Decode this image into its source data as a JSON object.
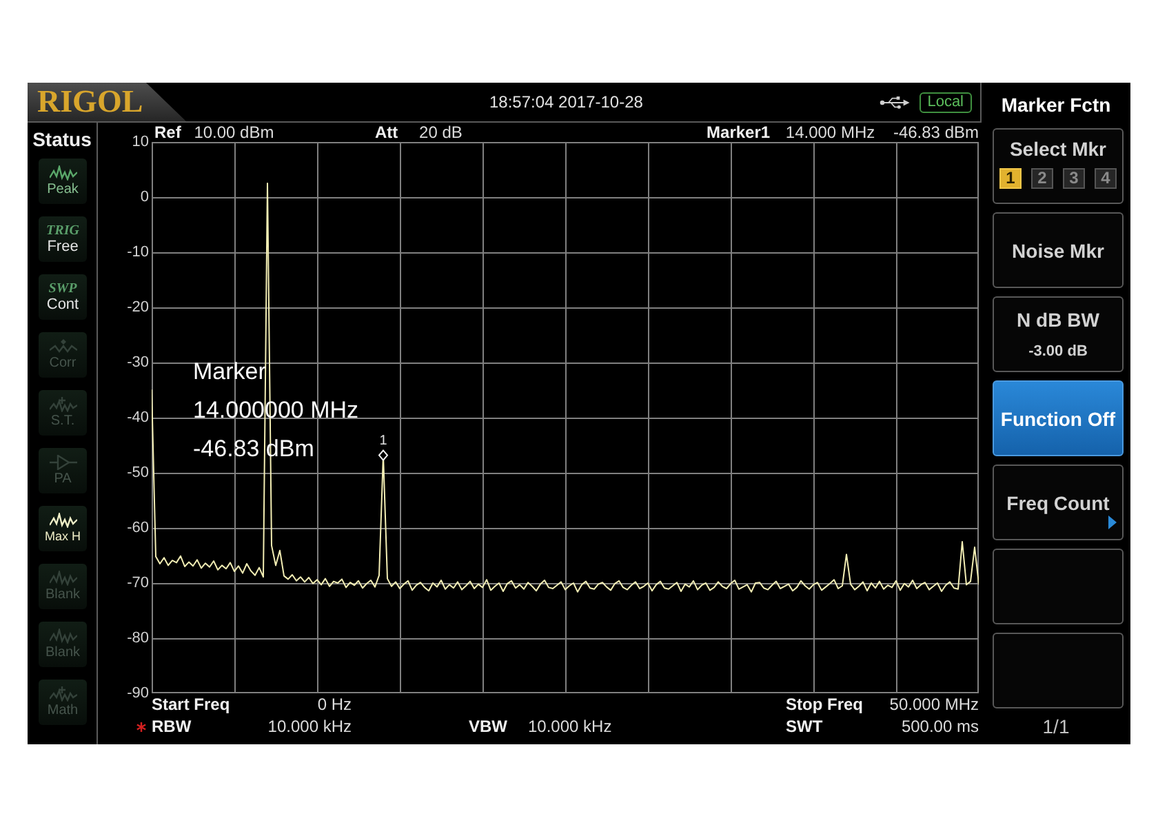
{
  "top_bar": {
    "logo": "RIGOL",
    "datetime": "18:57:04 2017-10-28",
    "remote_mode": "Local"
  },
  "status_panel": {
    "title": "Status",
    "items": [
      {
        "kind": "wave",
        "label": "Peak",
        "on": true,
        "selected": false
      },
      {
        "kind": "text",
        "heading": "TRIG",
        "label": "Free",
        "on": true,
        "selected": false
      },
      {
        "kind": "text",
        "heading": "SWP",
        "label": "Cont",
        "on": true,
        "selected": false
      },
      {
        "kind": "corr",
        "label": "Corr",
        "on": false,
        "selected": false
      },
      {
        "kind": "plus",
        "label": "S.T.",
        "on": false,
        "selected": false
      },
      {
        "kind": "amplifier",
        "label": "PA",
        "on": false,
        "selected": false
      },
      {
        "kind": "wave",
        "label": "Max H",
        "on": true,
        "selected": true
      },
      {
        "kind": "wave",
        "label": "Blank",
        "on": false,
        "selected": false
      },
      {
        "kind": "wave",
        "label": "Blank",
        "on": false,
        "selected": false
      },
      {
        "kind": "plus",
        "label": "Math",
        "on": false,
        "selected": false
      }
    ]
  },
  "plot": {
    "header": [
      {
        "label": "Ref",
        "value": "10.00 dBm"
      },
      {
        "label": "Att",
        "value": "20 dB"
      },
      {
        "label": "Marker1",
        "value": "14.000 MHz",
        "reading": "-46.83 dBm"
      }
    ],
    "chart_data": {
      "type": "line",
      "grid": true,
      "ylim": [
        -90,
        10
      ],
      "yticks": [
        10,
        0,
        -10,
        -20,
        -30,
        -40,
        -50,
        -60,
        -70,
        -80,
        -90
      ],
      "categories": [
        null,
        null,
        null,
        null,
        null,
        null,
        null,
        null,
        null,
        null,
        null,
        null,
        null,
        null,
        null,
        null,
        null,
        null,
        null,
        null,
        null,
        null,
        null,
        null,
        null,
        null,
        null,
        null,
        null,
        null,
        null,
        null,
        null,
        null,
        null,
        null,
        null,
        null,
        null,
        null,
        null,
        null,
        null,
        null,
        null,
        null,
        null,
        null,
        null,
        null,
        null,
        null,
        null,
        null,
        null,
        null,
        null,
        null,
        null,
        null,
        null,
        null,
        null,
        null,
        null,
        null,
        null,
        null,
        null,
        null,
        null,
        null,
        null,
        null,
        null,
        null,
        null,
        null,
        null,
        null,
        null,
        null,
        null,
        null,
        null,
        null,
        null,
        null,
        null,
        null,
        null,
        null,
        null,
        null,
        null,
        null,
        null,
        null,
        null,
        null,
        null,
        null,
        null,
        null,
        null,
        null,
        null,
        null,
        null,
        null,
        null,
        null,
        null,
        null,
        null,
        null,
        null,
        null,
        null,
        null,
        null,
        null,
        null,
        null,
        null,
        null,
        null,
        null,
        null,
        null,
        null,
        null,
        null,
        null,
        null,
        null,
        null,
        null,
        null,
        null,
        null,
        null,
        null,
        null,
        null,
        null,
        null,
        null,
        null,
        null,
        null,
        null,
        null,
        null,
        null,
        null,
        null,
        null,
        null,
        null,
        null,
        null,
        null,
        null,
        null,
        null,
        null,
        null,
        null,
        null,
        null,
        null,
        null,
        null,
        null,
        null,
        null,
        null,
        null,
        null,
        null,
        null,
        null,
        null,
        null,
        null,
        null,
        null,
        null,
        null,
        null,
        null,
        null,
        null,
        null,
        null,
        null,
        null,
        null,
        null,
        null
      ],
      "values": [
        -35,
        -65.2,
        -66.5,
        -65.4,
        -66.8,
        -65.9,
        -66.3,
        -65.1,
        -67.0,
        -66.2,
        -66.9,
        -65.8,
        -67.3,
        -66.4,
        -67.1,
        -66.0,
        -67.6,
        -66.8,
        -67.4,
        -66.3,
        -67.9,
        -66.9,
        -68.2,
        -66.5,
        -67.8,
        -68.6,
        -67.2,
        -68.9,
        2.5,
        -63.2,
        -66.8,
        -64.1,
        -68.7,
        -69.3,
        -68.5,
        -69.6,
        -68.9,
        -69.8,
        -69.0,
        -70.1,
        -69.4,
        -70.3,
        -69.2,
        -70.6,
        -69.7,
        -70.0,
        -69.3,
        -70.8,
        -69.9,
        -70.4,
        -69.6,
        -70.9,
        -70.1,
        -69.5,
        -70.7,
        -68.6,
        -46.8,
        -69.2,
        -70.6,
        -69.8,
        -71.0,
        -70.2,
        -69.6,
        -71.3,
        -70.4,
        -69.9,
        -70.8,
        -71.4,
        -70.0,
        -70.7,
        -69.5,
        -71.1,
        -70.3,
        -70.9,
        -69.8,
        -71.2,
        -70.5,
        -69.7,
        -71.0,
        -70.2,
        -70.8,
        -69.4,
        -71.3,
        -70.6,
        -70.0,
        -71.5,
        -70.1,
        -69.6,
        -70.9,
        -70.3,
        -71.1,
        -69.9,
        -70.6,
        -71.4,
        -70.2,
        -69.5,
        -70.8,
        -71.0,
        -70.4,
        -69.8,
        -71.2,
        -70.5,
        -70.0,
        -71.6,
        -70.3,
        -69.7,
        -70.9,
        -71.1,
        -70.2,
        -69.9,
        -70.7,
        -71.3,
        -70.1,
        -69.6,
        -70.8,
        -71.2,
        -70.4,
        -69.8,
        -71.0,
        -70.6,
        -70.0,
        -71.4,
        -70.3,
        -69.7,
        -70.9,
        -71.1,
        -70.5,
        -69.9,
        -71.5,
        -70.2,
        -70.7,
        -69.6,
        -71.2,
        -70.4,
        -70.0,
        -71.3,
        -70.8,
        -69.8,
        -70.6,
        -71.0,
        -70.1,
        -69.5,
        -71.1,
        -70.7,
        -70.3,
        -71.6,
        -70.0,
        -69.9,
        -70.9,
        -71.2,
        -70.4,
        -69.7,
        -71.0,
        -70.6,
        -70.2,
        -71.4,
        -70.8,
        -69.6,
        -70.5,
        -71.1,
        -70.3,
        -69.9,
        -71.3,
        -70.7,
        -70.1,
        -69.4,
        -71.0,
        -70.5,
        -64.8,
        -70.2,
        -71.2,
        -70.6,
        -69.8,
        -71.4,
        -70.0,
        -70.9,
        -69.7,
        -71.1,
        -70.4,
        -70.8,
        -69.6,
        -71.3,
        -70.1,
        -70.7,
        -69.5,
        -71.0,
        -70.3,
        -69.9,
        -71.2,
        -70.6,
        -70.0,
        -71.5,
        -70.4,
        -69.8,
        -70.9,
        -71.1,
        -62.5,
        -70.3,
        -69.7,
        -63.5,
        -70.2
      ]
    },
    "marker_label": "1",
    "marker_readout": [
      "Marker",
      "14.000000 MHz",
      "-46.83 dBm"
    ]
  },
  "footer": {
    "start": {
      "label": "Start Freq",
      "value": "0 Hz"
    },
    "stop": {
      "label": "Stop Freq",
      "value": "50.000 MHz"
    },
    "rbw": {
      "label": "RBW",
      "value": "10.000 kHz",
      "manual": true
    },
    "vbw": {
      "label": "VBW",
      "value": "10.000 kHz",
      "manual": false
    },
    "swt": {
      "label": "SWT",
      "value": "500.00 ms",
      "manual": false
    }
  },
  "menu": {
    "title": "Marker Fctn",
    "buttons": [
      {
        "kind": "markers",
        "label": "Select Mkr",
        "selected": false,
        "markers": [
          {
            "label": "1",
            "selected": true
          },
          {
            "label": "2",
            "selected": false
          },
          {
            "label": "3",
            "selected": false
          },
          {
            "label": "4",
            "selected": false
          }
        ]
      },
      {
        "kind": "plain",
        "label": "Noise Mkr",
        "selected": false
      },
      {
        "kind": "value",
        "label": "N dB BW",
        "value": "-3.00 dB",
        "selected": false
      },
      {
        "kind": "plain",
        "label": "Function Off",
        "selected": true
      },
      {
        "kind": "submenu",
        "label": "Freq Count",
        "selected": false
      },
      {
        "kind": "empty"
      },
      {
        "kind": "empty"
      }
    ],
    "page": "1/1"
  }
}
